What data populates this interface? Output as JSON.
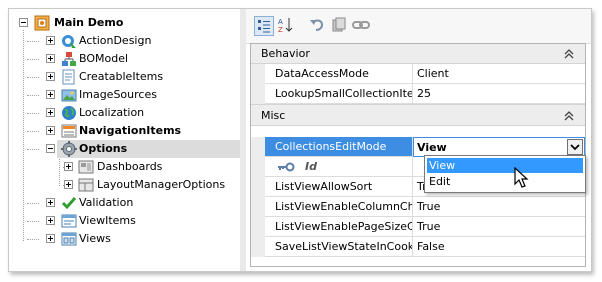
{
  "tree": {
    "items": [
      {
        "label": "Main Demo",
        "icon": "app-icon",
        "bold": true
      },
      {
        "label": "ActionDesign",
        "icon": "action-design-icon"
      },
      {
        "label": "BOModel",
        "icon": "bo-model-icon"
      },
      {
        "label": "CreatableItems",
        "icon": "creatable-items-icon"
      },
      {
        "label": "ImageSources",
        "icon": "image-sources-icon"
      },
      {
        "label": "Localization",
        "icon": "globe-icon"
      },
      {
        "label": "NavigationItems",
        "icon": "navigation-items-icon",
        "bold": true
      },
      {
        "label": "Options",
        "icon": "gear-icon",
        "bold": true,
        "selected": true
      },
      {
        "label": "Dashboards",
        "icon": "dashboards-icon"
      },
      {
        "label": "LayoutManagerOptions",
        "icon": "layout-manager-icon"
      },
      {
        "label": "Validation",
        "icon": "checkmark-icon"
      },
      {
        "label": "ViewItems",
        "icon": "view-items-icon"
      },
      {
        "label": "Views",
        "icon": "views-icon"
      }
    ]
  },
  "grid": {
    "categories": {
      "behavior": "Behavior",
      "misc": "Misc"
    },
    "behavior_rows": [
      {
        "name": "DataAccessMode",
        "value": "Client"
      },
      {
        "name": "LookupSmallCollectionItemCount",
        "value": "25"
      }
    ],
    "misc_rows": [
      {
        "name": "CollectionsEditMode",
        "value": "View"
      },
      {
        "name": "Id",
        "value": ""
      },
      {
        "name": "ListViewAllowSort",
        "value": "True"
      },
      {
        "name": "ListViewEnableColumnChooser",
        "value": "True"
      },
      {
        "name": "ListViewEnablePageSizeChooser",
        "value": "True"
      },
      {
        "name": "SaveListViewStateInCookies",
        "value": "False"
      }
    ]
  },
  "dropdown": {
    "options": [
      "View",
      "Edit"
    ],
    "highlighted": "View"
  },
  "colors": {
    "selection_blue": "#3d8ee3",
    "highlight_blue": "#3399ff",
    "tree_selected_bg": "#dcdcdc"
  }
}
